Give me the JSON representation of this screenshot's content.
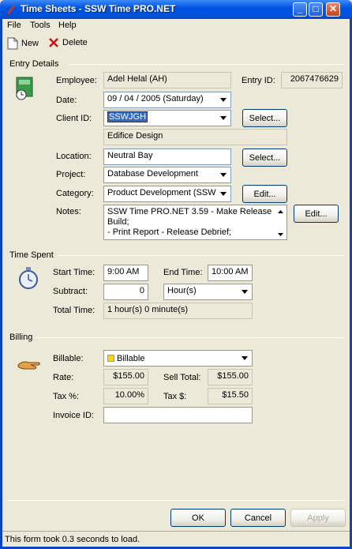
{
  "window": {
    "title": "Time Sheets - SSW Time PRO.NET"
  },
  "menu": [
    "File",
    "Tools",
    "Help"
  ],
  "toolbar": {
    "new_label": "New",
    "delete_label": "Delete"
  },
  "entry": {
    "section_title": "Entry Details",
    "employee_label": "Employee:",
    "employee_value": "Adel Helal (AH)",
    "entry_id_label": "Entry ID:",
    "entry_id_value": "2067476629",
    "date_label": "Date:",
    "date_value": "09 / 04 / 2005 (Saturday)",
    "client_label": "Client ID:",
    "client_value": "SSWJGH",
    "client_name": "Edifice Design",
    "select_label": "Select...",
    "location_label": "Location:",
    "location_value": "Neutral Bay",
    "project_label": "Project:",
    "project_value": "Database Development",
    "category_label": "Category:",
    "category_value": "Product Development (SSW",
    "edit_label": "Edit...",
    "notes_label": "Notes:",
    "notes_lines": [
      "SSW Time PRO.NET 3.59 - Make Release",
      "Build;",
      "- Print Report - Release Debrief;"
    ]
  },
  "time": {
    "section_title": "Time Spent",
    "start_label": "Start Time:",
    "start_value": "9:00 AM",
    "end_label": "End Time:",
    "end_value": "10:00 AM",
    "subtract_label": "Subtract:",
    "subtract_value": "0",
    "subtract_unit": "Hour(s)",
    "total_label": "Total Time:",
    "total_value": "1 hour(s) 0 minute(s)"
  },
  "billing": {
    "section_title": "Billing",
    "billable_label": "Billable:",
    "billable_value": "Billable",
    "billable_color": "#ffd700",
    "rate_label": "Rate:",
    "rate_value": "$155.00",
    "sell_total_label": "Sell Total:",
    "sell_total_value": "$155.00",
    "tax_pct_label": "Tax %:",
    "tax_pct_value": "10.00%",
    "tax_amt_label": "Tax $:",
    "tax_amt_value": "$15.50",
    "invoice_label": "Invoice ID:",
    "invoice_value": ""
  },
  "buttons": {
    "ok": "OK",
    "cancel": "Cancel",
    "apply": "Apply"
  },
  "status": "This form took 0.3 seconds to load."
}
